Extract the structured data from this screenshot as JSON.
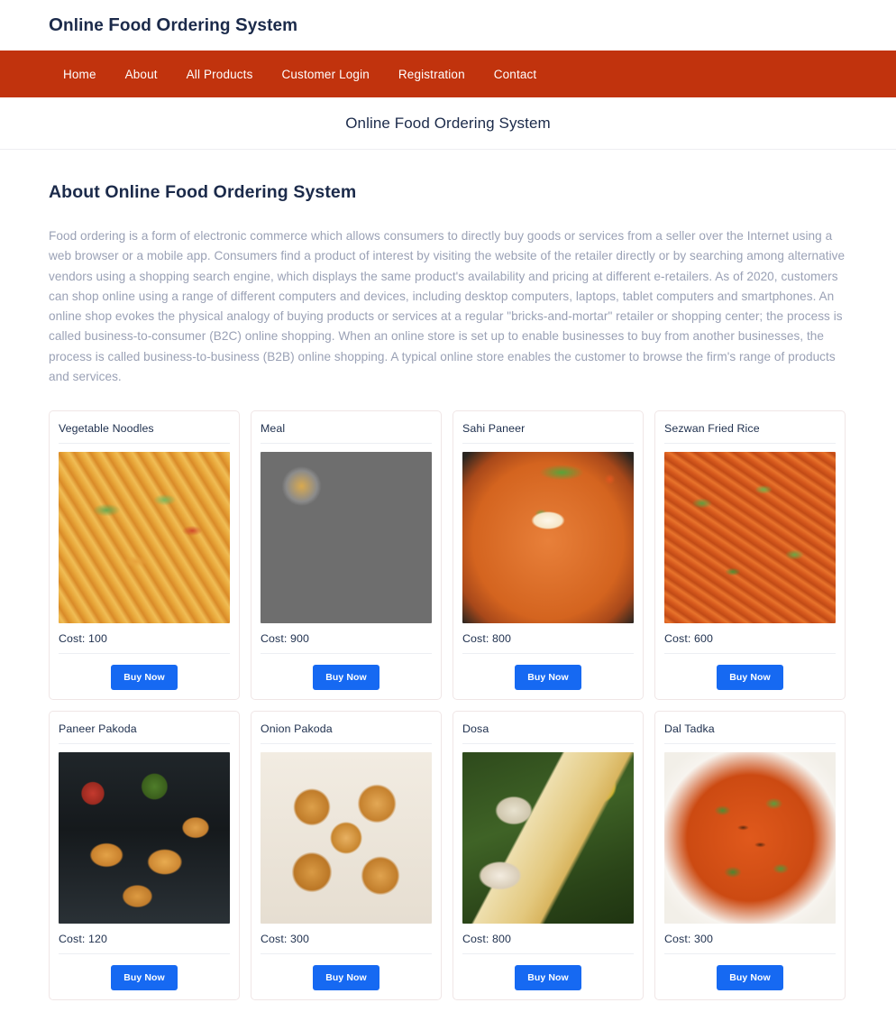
{
  "brand": {
    "title_parts": [
      {
        "cap": "O",
        "rest": "nline "
      },
      {
        "cap": "F",
        "rest": "ood "
      },
      {
        "cap": "O",
        "rest": "rdering "
      },
      {
        "cap": "S",
        "rest": "ystem"
      }
    ],
    "title_plain": "Online Food Ordering System"
  },
  "nav": {
    "items": [
      {
        "label": "Home"
      },
      {
        "label": "About"
      },
      {
        "label": "All Products"
      },
      {
        "label": "Customer Login"
      },
      {
        "label": "Registration"
      },
      {
        "label": "Contact"
      }
    ]
  },
  "page": {
    "subtitle": "Online Food Ordering System",
    "section_heading": "About Online Food Ordering System",
    "about_paragraph": "Food ordering is a form of electronic commerce which allows consumers to directly buy goods or services from a seller over the Internet using a web browser or a mobile app. Consumers find a product of interest by visiting the website of the retailer directly or by searching among alternative vendors using a shopping search engine, which displays the same product's availability and pricing at different e-retailers. As of 2020, customers can shop online using a range of different computers and devices, including desktop computers, laptops, tablet computers and smartphones. An online shop evokes the physical analogy of buying products or services at a regular \"bricks-and-mortar\" retailer or shopping center; the process is called business-to-consumer (B2C) online shopping. When an online store is set up to enable businesses to buy from another businesses, the process is called business-to-business (B2B) online shopping. A typical online store enables the customer to browse the firm's range of products and services."
  },
  "colors": {
    "navbar": "#c1330d",
    "heading": "#1b2a4a",
    "body_text": "#9aa1b5",
    "buy_button": "#1669f2",
    "card_border": "#f0e6e6"
  },
  "buy_button_label": "Buy Now",
  "products": [
    {
      "name": "Vegetable Noodles",
      "cost_label": "Cost: 100",
      "cost": 100,
      "image_class": "food-noodles",
      "image_name": "vegetable-noodles-photo"
    },
    {
      "name": "Meal",
      "cost_label": "Cost: 900",
      "cost": 900,
      "image_class": "food-meal",
      "image_name": "meal-thali-photo"
    },
    {
      "name": "Sahi Paneer",
      "cost_label": "Cost: 800",
      "cost": 800,
      "image_class": "food-paneer",
      "image_name": "sahi-paneer-photo"
    },
    {
      "name": "Sezwan Fried Rice",
      "cost_label": "Cost: 600",
      "cost": 600,
      "image_class": "food-friedrice",
      "image_name": "sezwan-fried-rice-photo"
    },
    {
      "name": "Paneer Pakoda",
      "cost_label": "Cost: 120",
      "cost": 120,
      "image_class": "food-pakoda",
      "image_name": "paneer-pakoda-photo"
    },
    {
      "name": "Onion Pakoda",
      "cost_label": "Cost: 300",
      "cost": 300,
      "image_class": "food-onionpakoda",
      "image_name": "onion-pakoda-photo"
    },
    {
      "name": "Dosa",
      "cost_label": "Cost: 800",
      "cost": 800,
      "image_class": "food-dosa",
      "image_name": "dosa-photo"
    },
    {
      "name": "Dal Tadka",
      "cost_label": "Cost: 300",
      "cost": 300,
      "image_class": "food-dal",
      "image_name": "dal-tadka-photo"
    }
  ]
}
